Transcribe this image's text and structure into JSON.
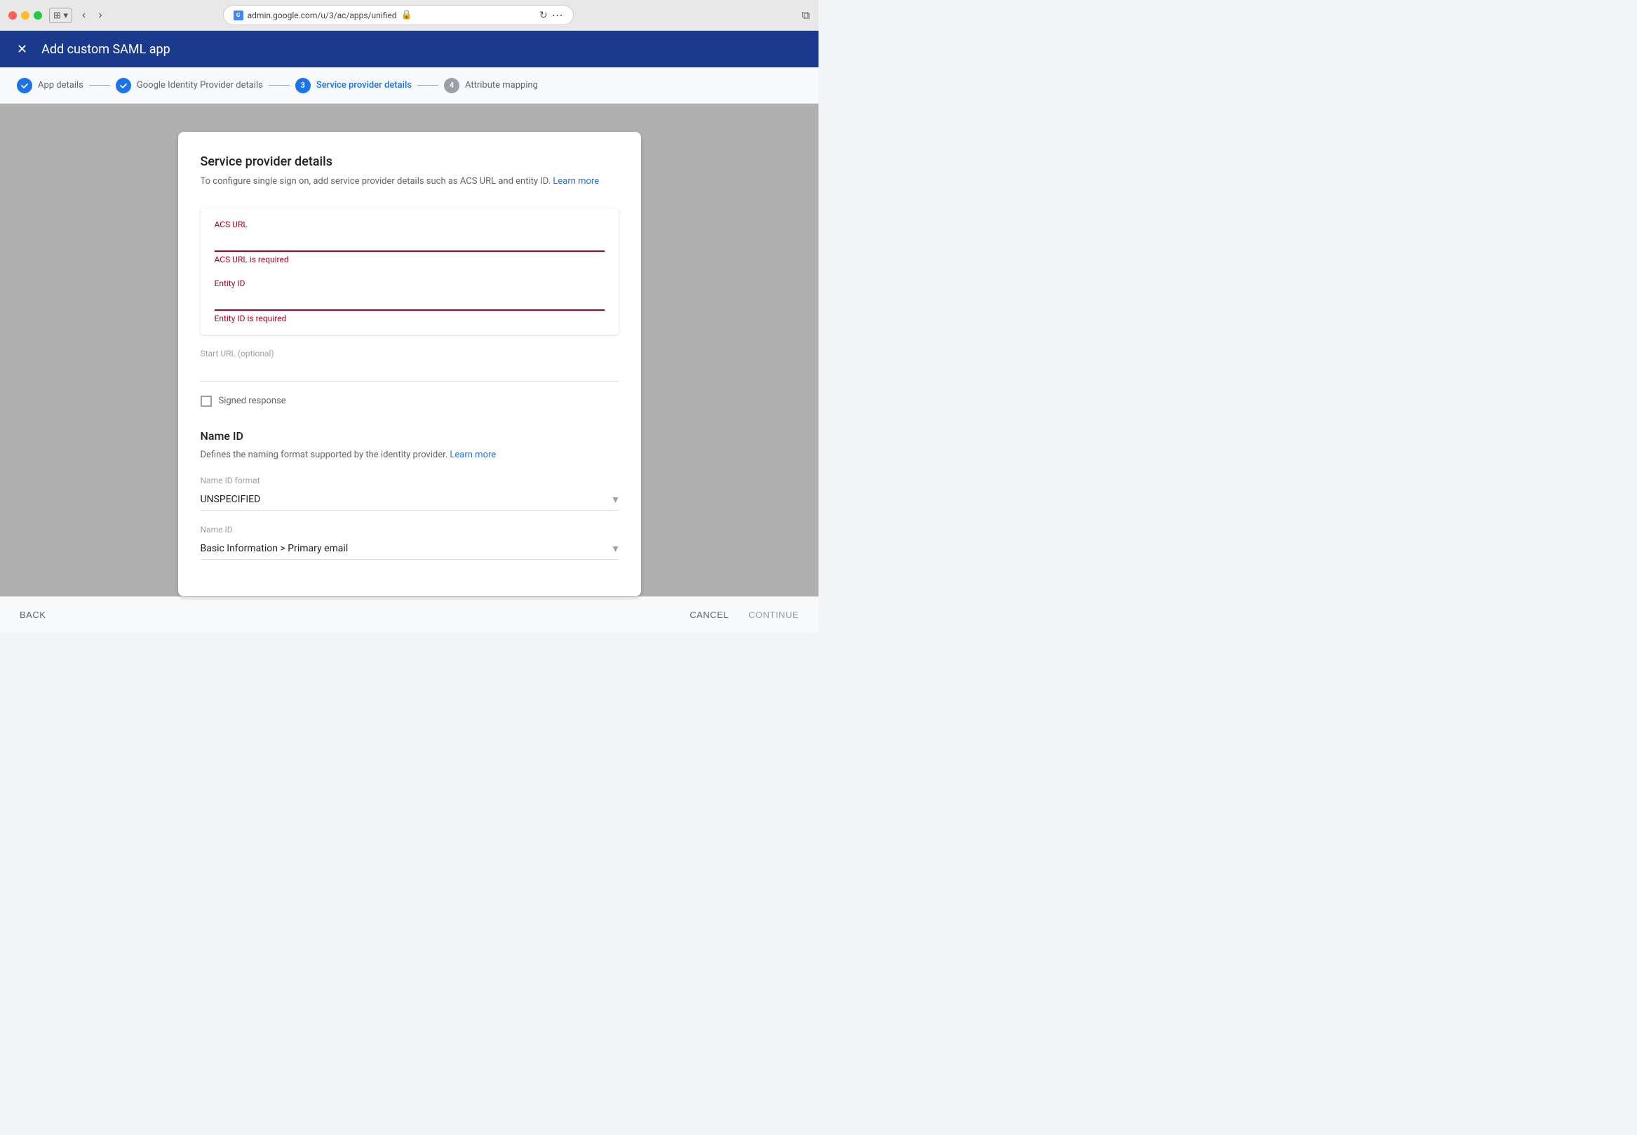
{
  "browser": {
    "url": "admin.google.com/u/3/ac/apps/unified",
    "favicon_label": "G"
  },
  "header": {
    "title": "Add custom SAML app",
    "close_icon": "×"
  },
  "steps": [
    {
      "id": 1,
      "label": "App details",
      "state": "done"
    },
    {
      "id": 2,
      "label": "Google Identity Provider details",
      "state": "done"
    },
    {
      "id": 3,
      "label": "Service provider details",
      "state": "active"
    },
    {
      "id": 4,
      "label": "Attribute mapping",
      "state": "inactive"
    }
  ],
  "form": {
    "title": "Service provider details",
    "description": "To configure single sign on, add service provider details such as ACS URL and entity ID.",
    "learn_more_link": "Learn more",
    "fields": {
      "acs_url": {
        "label": "ACS URL",
        "value": "",
        "placeholder": "",
        "error": "ACS URL is required"
      },
      "entity_id": {
        "label": "Entity ID",
        "value": "",
        "placeholder": "",
        "error": "Entity ID is required"
      },
      "start_url": {
        "label": "Start URL (optional)",
        "value": ""
      },
      "signed_response": {
        "label": "Signed response"
      }
    },
    "name_id": {
      "section_title": "Name ID",
      "description": "Defines the naming format supported by the identity provider.",
      "learn_more_link": "Learn more",
      "name_id_format": {
        "label": "Name ID format",
        "value": "UNSPECIFIED"
      },
      "name_id": {
        "label": "Name ID",
        "value": "Basic Information > Primary email"
      }
    }
  },
  "footer": {
    "back_label": "BACK",
    "cancel_label": "CANCEL",
    "continue_label": "CONTINUE"
  }
}
